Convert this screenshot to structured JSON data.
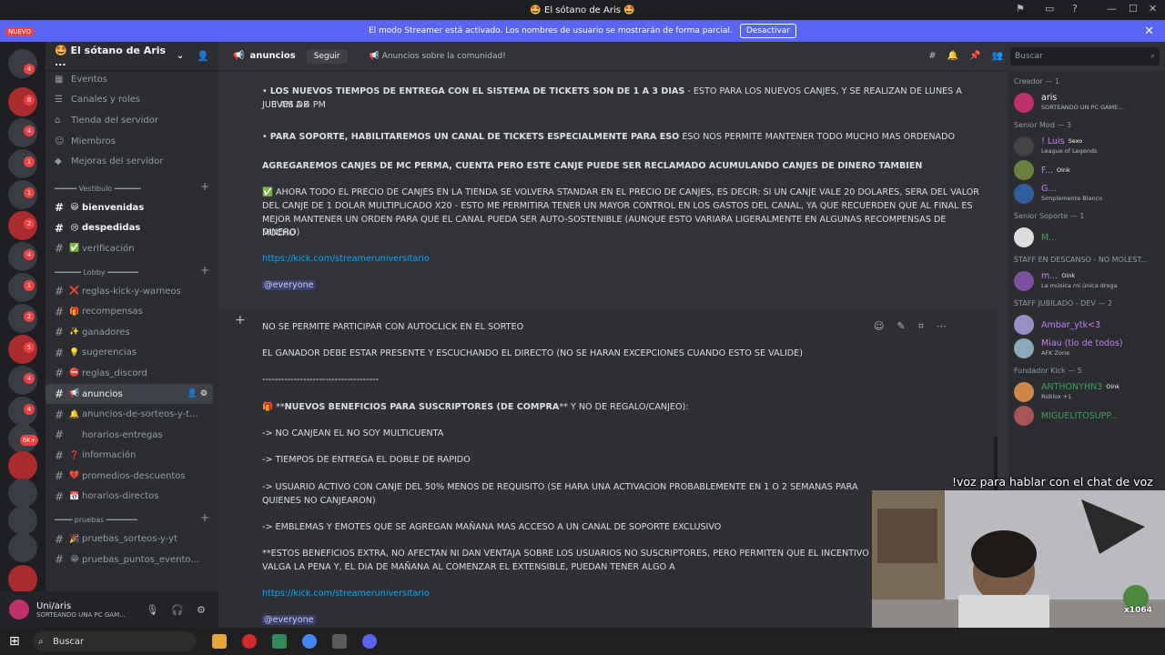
{
  "window": {
    "title": "🤩 El sótano de Aris 🤩"
  },
  "streamer": {
    "message": "El modo Streamer está activado. Los nombres de usuario se mostrarán de forma parcial.",
    "button": "Desactivar"
  },
  "guilds": {
    "new_label": "NUEVO",
    "badges": [
      "4",
      "8",
      "4",
      "1",
      "1",
      "2",
      "4",
      "1",
      "2",
      "5",
      "4",
      "4",
      "6K+"
    ]
  },
  "server": {
    "name": "🤩 El sótano de Aris ..."
  },
  "nav": [
    "Eventos",
    "Canales y roles",
    "Tienda del servidor",
    "Miembros",
    "Mejoras del servidor"
  ],
  "categories": [
    {
      "name": "Vestíbulo",
      "label": "━━━━━ Vestibulo ━━━━━━",
      "channels": [
        {
          "emoji": "😃",
          "name": "bienvenidas",
          "bold": true
        },
        {
          "emoji": "😢",
          "name": "despedidas",
          "bold": true
        },
        {
          "emoji": "✅",
          "name": "verificación",
          "bold": false
        }
      ]
    },
    {
      "name": "Lobby",
      "label": "━━━━━━ Lobby ━━━━━━━",
      "channels": [
        {
          "emoji": "❌",
          "name": "reglas-kick-y-warneos"
        },
        {
          "emoji": "🎁",
          "name": "recompensas"
        },
        {
          "emoji": "✨",
          "name": "ganadores"
        },
        {
          "emoji": "💡",
          "name": "sugerencias"
        },
        {
          "emoji": "⛔",
          "name": "reglas_discord"
        },
        {
          "emoji": "📢",
          "name": "anuncios",
          "selected": true
        },
        {
          "emoji": "🔔",
          "name": "anuncios-de-sorteos-y-t..."
        },
        {
          "emoji": "",
          "name": "horarios-entregas"
        },
        {
          "emoji": "❓",
          "name": "información"
        },
        {
          "emoji": "💔",
          "name": "promedios-descuentos"
        },
        {
          "emoji": "📅",
          "name": "horarios-directos"
        }
      ]
    },
    {
      "name": "pruebas",
      "label": "━━━━ pruebas ━━━━━━━",
      "channels": [
        {
          "emoji": "🎉",
          "name": "pruebas_sorteos-y-yt"
        },
        {
          "emoji": "😁",
          "name": "pruebas_puntos_evento..."
        }
      ]
    }
  ],
  "user": {
    "name": "Uni/aris",
    "status": "SORTEANDO UNA PC GAM..."
  },
  "channel": {
    "name": "anuncios",
    "follow": "Seguir",
    "topic": "📢 Anuncios sobre la comunidad!"
  },
  "search": {
    "placeholder": "Buscar"
  },
  "messages": {
    "m1": "LOS NUEVOS TIEMPOS DE ENTREGA CON EL SISTEMA DE TICKETS SON DE 1 A 3 DIAS",
    "m1b": " - ESTO PARA LOS NUEVOS CANJES, Y SE REALIZAN DE LUNES A JUEVES DE",
    "m1c": "8 AM A 4 PM",
    "m2": "PARA SOPORTE, HABILITAREMOS UN CANAL DE TICKETS ESPECIALMENTE PARA ESO",
    "m2b": " ESO NOS PERMITE MANTENER TODO MUCHO MAS ORDENADO",
    "m3": "AGREGAREMOS CANJES DE MC PERMA, CUENTA PERO ESTE CANJE PUEDE SER RECLAMADO ACUMULANDO CANJES DE DINERO TAMBIEN",
    "m4a": "✅ AHORA TODO EL PRECIO DE CANJES EN LA TIENDA SE VOLVERA STANDAR EN EL PRECIO DE CANJES, ES DECIR: SI UN CANJE VALE 20 DOLARES, SERA DEL VALOR",
    "m4b": "DEL CANJE DE 1 DOLAR MULTIPLICADO X20 - ESTO ME PERMITIRA TENER UN MAYOR CONTROL EN LOS GASTOS DEL CANAL, YA QUE RECUERDEN QUE AL FINAL ES",
    "m4c": "MEJOR MANTENER UN ORDEN PARA QUE EL CANAL PUEDA SER AUTO-SOSTENIBLE (AUNQUE ESTO VARIARA LIGERALMENTE EN ALGUNAS RECOMPENSAS DE MUCHO",
    "m4d": "DINERO)",
    "link": "https://kick.com/streameruniversitario",
    "everyone": "@everyone",
    "e1": "NO SE PERMITE PARTICIPAR CON AUTOCLICK EN EL SORTEO",
    "e2": "EL GANADOR DEBE ESTAR PRESENTE Y ESCUCHANDO EL DIRECTO (NO SE HARAN EXCEPCIONES CUANDO ESTO SE VALIDE)",
    "e3": "-------------------------------------",
    "e4a": "🎁 **",
    "e4b": "NUEVOS BENEFICIOS PARA SUSCRIPTORES (DE COMPRA",
    "e4c": "** Y NO DE REGALO/CANJEO):",
    "e5": "-> NO CANJEAN EL NO SOY MULTICUENTA",
    "e6": "-> TIEMPOS DE ENTREGA EL DOBLE DE RAPIDO",
    "e7a": "-> USUARIO ACTIVO CON CANJE DEL 50% MENOS DE REQUISITO (SE HARA UNA ACTIVACION PROBABLEMENTE EN 1 O 2 SEMANAS PARA",
    "e7b": "QUIENES NO CANJEARON)",
    "e8": "-> EMBLEMAS Y EMOTES QUE SE AGREGAN MAÑANA MAS ACCESO A UN CANAL DE SOPORTE EXCLUSIVO",
    "e9a": "**ESTOS BENEFICIOS EXTRA, NO AFECTAN NI DAN VENTAJA SOBRE LOS USUARIOS NO SUSCRIPTORES, PERO PERMITEN QUE EL INCENTIVO",
    "e9b": "VALGA LA PENA Y, EL DIA DE MAÑANA AL COMENZAR EL EXTENSIBLE, PUEDAN TENER ALGO A"
  },
  "members": [
    {
      "cat": "Creador — 1",
      "list": [
        {
          "name": "aris",
          "status": "SORTEANDO UN PC GAME...",
          "color": "#f2f3f5"
        }
      ]
    },
    {
      "cat": "Senior Mod — 3",
      "list": [
        {
          "name": "! Luis",
          "badge": "Sexo",
          "status": "League of Legends",
          "color": "#c77dff"
        },
        {
          "name": "F...",
          "badge": "Oink",
          "status": "",
          "color": "#c77dff"
        },
        {
          "name": "G...",
          "status": "Simplemente Blanco",
          "color": "#c77dff"
        }
      ]
    },
    {
      "cat": "Senior Soporte — 1",
      "list": [
        {
          "name": "M...",
          "status": "",
          "color": "#3ba55d"
        }
      ]
    },
    {
      "cat": "STAFF EN DESCANSO - NO MOLEST...",
      "list": [
        {
          "name": "m...",
          "badge": "Oink",
          "status": "La música mi única droga",
          "color": "#c77dff"
        }
      ]
    },
    {
      "cat": "STAFF JUBILADO - DEV — 2",
      "list": [
        {
          "name": "Ambar_ytk<3",
          "status": "",
          "color": "#c77dff"
        },
        {
          "name": "Miau (tío de todos)",
          "status": "AFK Zone",
          "color": "#c77dff"
        }
      ]
    },
    {
      "cat": "Fundador Kick — 5",
      "list": [
        {
          "name": "ANTHONYHN3",
          "badge": "Oink",
          "status": "Roblox +1",
          "color": "#3ba55d"
        },
        {
          "name": "MIGUELITOSUPP...",
          "status": "",
          "color": "#3ba55d"
        }
      ]
    }
  ],
  "overlay": {
    "caption": "!voz para hablar con el chat de voz",
    "tag": "x1064"
  },
  "taskbar": {
    "search": "Buscar"
  }
}
